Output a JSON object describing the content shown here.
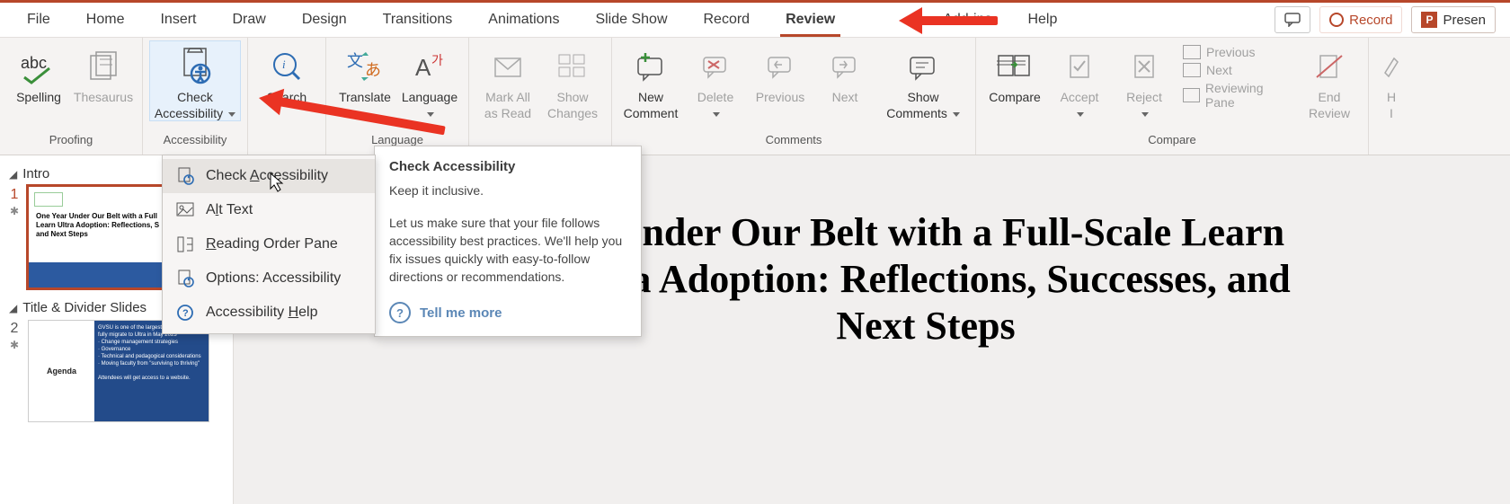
{
  "tabs": {
    "items": [
      "File",
      "Home",
      "Insert",
      "Draw",
      "Design",
      "Transitions",
      "Animations",
      "Slide Show",
      "Record",
      "Review",
      "Add-ins",
      "Help"
    ],
    "active": "Review"
  },
  "topright": {
    "comment_bubble_title": "Comments",
    "record_label": "Record",
    "present_label": "Presen"
  },
  "ribbon": {
    "proofing": {
      "label": "Proofing",
      "spelling": "Spelling",
      "thesaurus": "Thesaurus"
    },
    "accessibility": {
      "label": "Accessibility",
      "check_line1": "Check",
      "check_line2": "Accessibility"
    },
    "search": {
      "label": "Search"
    },
    "language": {
      "label": "Language",
      "translate": "Translate",
      "language": "Language"
    },
    "changes": {
      "markall_l1": "Mark All",
      "markall_l2": "as Read",
      "show_l1": "Show",
      "show_l2": "Changes"
    },
    "comments": {
      "label": "Comments",
      "new_l1": "New",
      "new_l2": "Comment",
      "delete": "Delete",
      "previous": "Previous",
      "next": "Next",
      "show_l1": "Show",
      "show_l2": "Comments"
    },
    "compare": {
      "label": "Compare",
      "compare": "Compare",
      "accept": "Accept",
      "reject": "Reject",
      "previous": "Previous",
      "next": "Next",
      "reviewing_pane": "Reviewing Pane",
      "end_l1": "End",
      "end_l2": "Review"
    },
    "ink": {
      "hide": "H",
      "in": "I"
    }
  },
  "dropdown": {
    "items": [
      {
        "label": "Check Accessibility",
        "key": "A"
      },
      {
        "label": "Alt Text",
        "key": "l"
      },
      {
        "label": "Reading Order Pane",
        "key": "R"
      },
      {
        "label": "Options: Accessibility",
        "key": ""
      },
      {
        "label": "Accessibility Help",
        "key": "H"
      }
    ]
  },
  "tooltip": {
    "title": "Check Accessibility",
    "subtitle": "Keep it inclusive.",
    "body": "Let us make sure that your file follows accessibility best practices. We'll help you fix issues quickly with easy-to-follow directions or recommendations.",
    "link": "Tell me more"
  },
  "thumbs": {
    "section1": "Intro",
    "section2": "Title & Divider Slides",
    "slide1_l1": "One Year Under Our Belt with a Full",
    "slide1_l2": "Learn Ultra Adoption: Reflections, S",
    "slide1_l3": "and Next Steps",
    "slide2_label": "Agenda"
  },
  "slide": {
    "title": "ar Under Our Belt with a Full-Scale Learn Ultra Adoption: Reflections, Successes, and Next Steps"
  },
  "colors": {
    "accent": "#b7472a",
    "arrow": "#ea3323"
  }
}
